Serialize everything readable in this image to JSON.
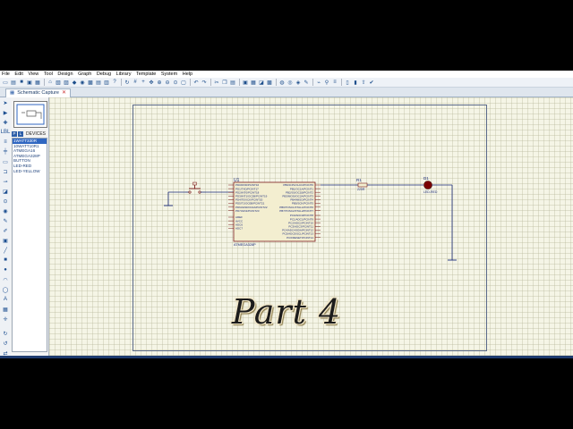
{
  "menu": [
    "File",
    "Edit",
    "View",
    "Tool",
    "Design",
    "Graph",
    "Debug",
    "Library",
    "Template",
    "System",
    "Help"
  ],
  "tab": {
    "label": "Schematic Capture",
    "close": "✕"
  },
  "panel": {
    "p_label": "P",
    "l_label": "L",
    "devices_label": "DEVICES",
    "devices": [
      "1WATT330R",
      "10WATT10R1",
      "ATMEGA16",
      "ATMEGA328P",
      "BUTTON",
      "LED-RED",
      "LED-YELLOW"
    ],
    "selected_index": 0
  },
  "schematic": {
    "mcu_ref": "U1",
    "mcu_part": "ATMEGA328P",
    "resistor_ref": "R1",
    "resistor_value": "220R",
    "led_ref": "D1",
    "led_part": "LED-RED",
    "left_pins": [
      "PD0/RXD/PCINT16",
      "PD1/TXD/PCINT17",
      "PD2/INT0/PCINT18",
      "PD3/INT1/OC2B/PCINT19",
      "PD4/T0/XCK/PCINT20",
      "PD5/T1/OC0B/PCINT21",
      "PD6/AIN0/OC0A/PCINT22",
      "PD7/AIN1/PCINT23"
    ],
    "left_pins2": [
      "AREF",
      "AVCC",
      "ADC6",
      "ADC7"
    ],
    "right_pins": [
      "PB0/ICP1/CLKO/PCINT0",
      "PB1/OC1A/PCINT1",
      "PB2/SS/OC1B/PCINT2",
      "PB3/MOSI/OC2A/PCINT3",
      "PB4/MISO/PCINT4",
      "PB5/SCK/PCINT5",
      "PB6/TOSC1/XTAL1/PCINT6",
      "PB7/TOSC2/XTAL2/PCINT7"
    ],
    "right_pins2": [
      "PC0/ADC0/PCINT8",
      "PC1/ADC1/PCINT9",
      "PC2/ADC2/PCINT10",
      "PC3/ADC3/PCINT11",
      "PC4/ADC4/SDA/PCINT12",
      "PC5/ADC5/SCL/PCINT13",
      "PC6/RESET/PCINT14"
    ]
  },
  "caption": "Part 4",
  "colors": {
    "canvas": "#f5f5e6",
    "wire": "#1a2a7a",
    "component_fill": "#f3eed0",
    "led": "#7a0000",
    "selection": "#2f66c1"
  }
}
